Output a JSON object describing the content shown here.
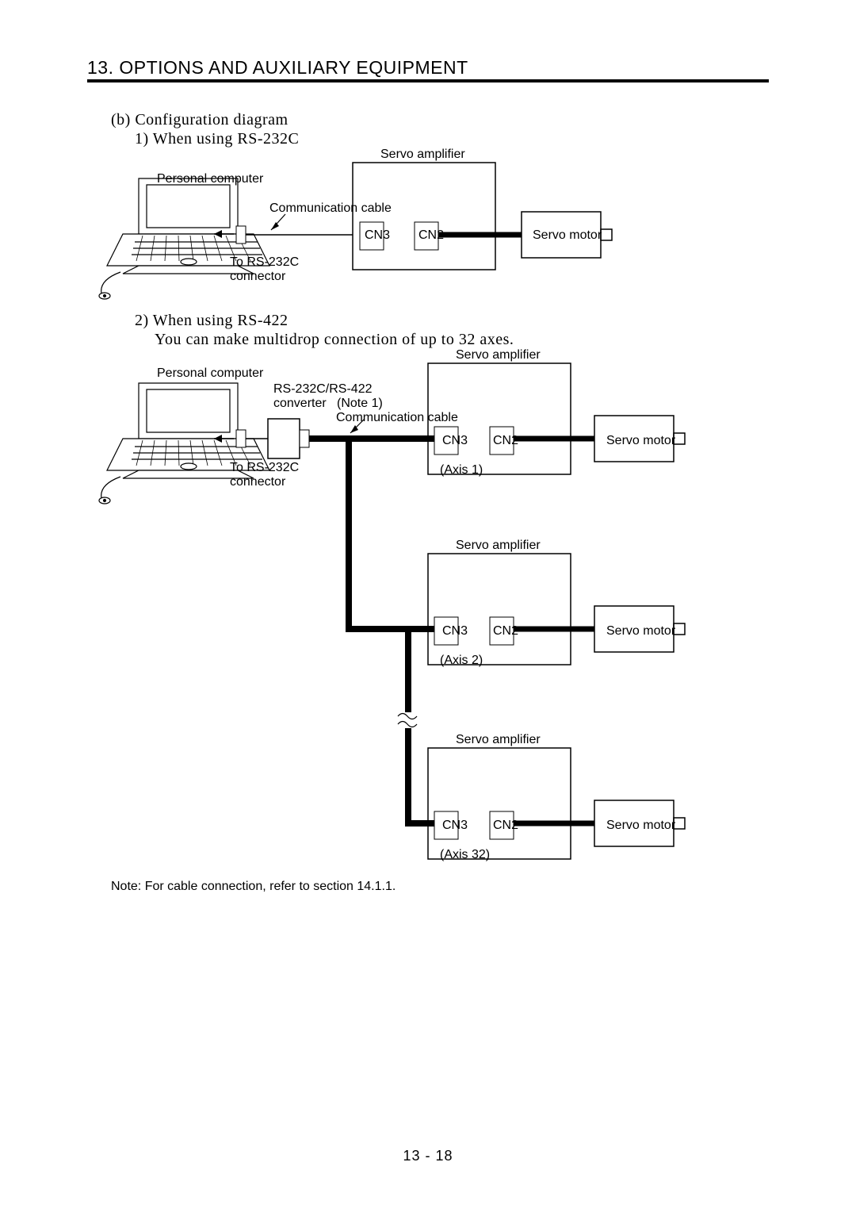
{
  "header": {
    "title": "13. OPTIONS AND AUXILIARY EQUIPMENT"
  },
  "section": {
    "b": "(b) Configuration diagram",
    "item1": "1) When using RS-232C",
    "item2": "2) When using RS-422",
    "item2_sub": "You can make multidrop connection of up to 32 axes."
  },
  "labels": {
    "personal_computer": "Personal computer",
    "communication_cable": "Communication cable",
    "servo_amplifier": "Servo amplifier",
    "cn3": "CN3",
    "cn2": "CN2",
    "servo_motor": "Servo motor",
    "to_rs232c": "To RS-232C",
    "connector": "connector",
    "rs232c_rs422": "RS-232C/RS-422",
    "converter": "converter",
    "note1": "(Note 1)",
    "axis1": "(Axis 1)",
    "axis2": "(Axis 2)",
    "axis32": "(Axis 32)"
  },
  "note": "Note: For cable connection, refer to section 14.1.1.",
  "page_number": "13 -  18"
}
